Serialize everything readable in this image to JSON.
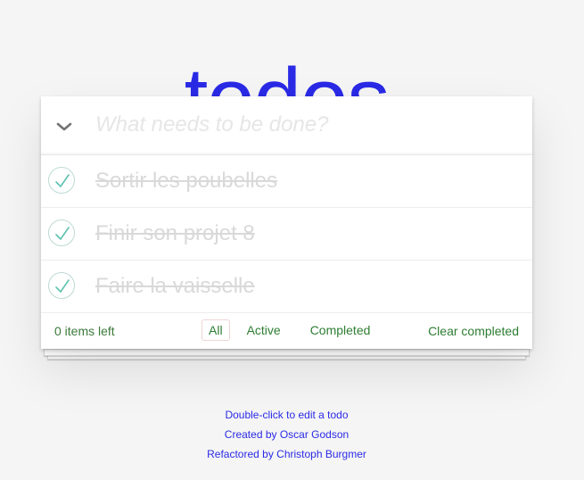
{
  "app": {
    "title": "todos"
  },
  "new_todo": {
    "placeholder": "What needs to be done?",
    "value": ""
  },
  "todos": [
    {
      "label": "Sortir les poubelles",
      "completed": true
    },
    {
      "label": "Finir son projet 8",
      "completed": true
    },
    {
      "label": "Faire la vaisselle",
      "completed": true
    }
  ],
  "footer": {
    "items_left": "0 items left",
    "filters": [
      "All",
      "Active",
      "Completed"
    ],
    "selected_filter": "All",
    "clear_completed": "Clear completed"
  },
  "info": {
    "line1": "Double-click to edit a todo",
    "line2": "Created by Oscar Godson",
    "line3": "Refactored by Christoph Burgmer"
  },
  "colors": {
    "title": "#2a2ae6",
    "footer_text": "#2e7d32",
    "check": "#5dc2af"
  },
  "icons": {
    "toggle_all": "chevron-down-icon",
    "todo_toggle": "check-icon"
  }
}
